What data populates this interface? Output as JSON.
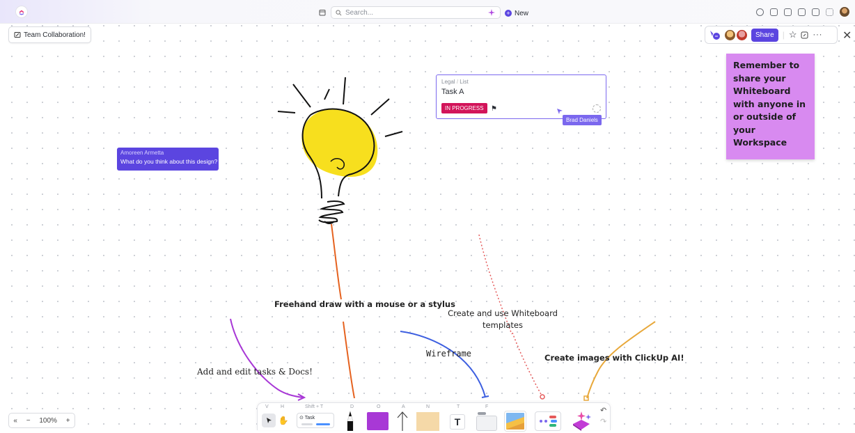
{
  "topbar": {
    "search_placeholder": "Search...",
    "new_label": "New",
    "logo_icon": "clickup-logo-icon"
  },
  "board": {
    "title": "Team Collaboration!",
    "share_label": "Share"
  },
  "sticky_note": {
    "text": "Remember to share your Whiteboard with anyone in or outside of your Workspace",
    "color": "#d88af0"
  },
  "chat": {
    "author": "Amoreen Armetta",
    "message": "What do you think about this design?"
  },
  "task_card": {
    "crumb_space": "Legal",
    "crumb_list": "List",
    "name": "Task A",
    "status": "IN PROGRESS",
    "status_color": "#d2145a",
    "cursor_user": "Brad Daniels"
  },
  "annotations": {
    "freehand": "Freehand draw with a mouse or a stylus",
    "templates": "Create and use Whiteboard templates",
    "wireframe": "Wireframe",
    "ai_images": "Create images with ClickUp AI!",
    "tasks_docs": "Add and edit tasks & Docs!"
  },
  "zoom": {
    "level": "100%",
    "minus": "−",
    "plus": "+"
  },
  "toolbar": {
    "hotkeys": {
      "select": "V",
      "hand": "H",
      "task": "Shift + T",
      "draw": "D",
      "shape": "O",
      "arrow": "A",
      "note": "N",
      "text": "T",
      "card": "F"
    },
    "task_tool_label": "Task",
    "text_tool_label": "T"
  },
  "colors": {
    "accent": "#5b45e0",
    "shape": "#a838d6"
  }
}
